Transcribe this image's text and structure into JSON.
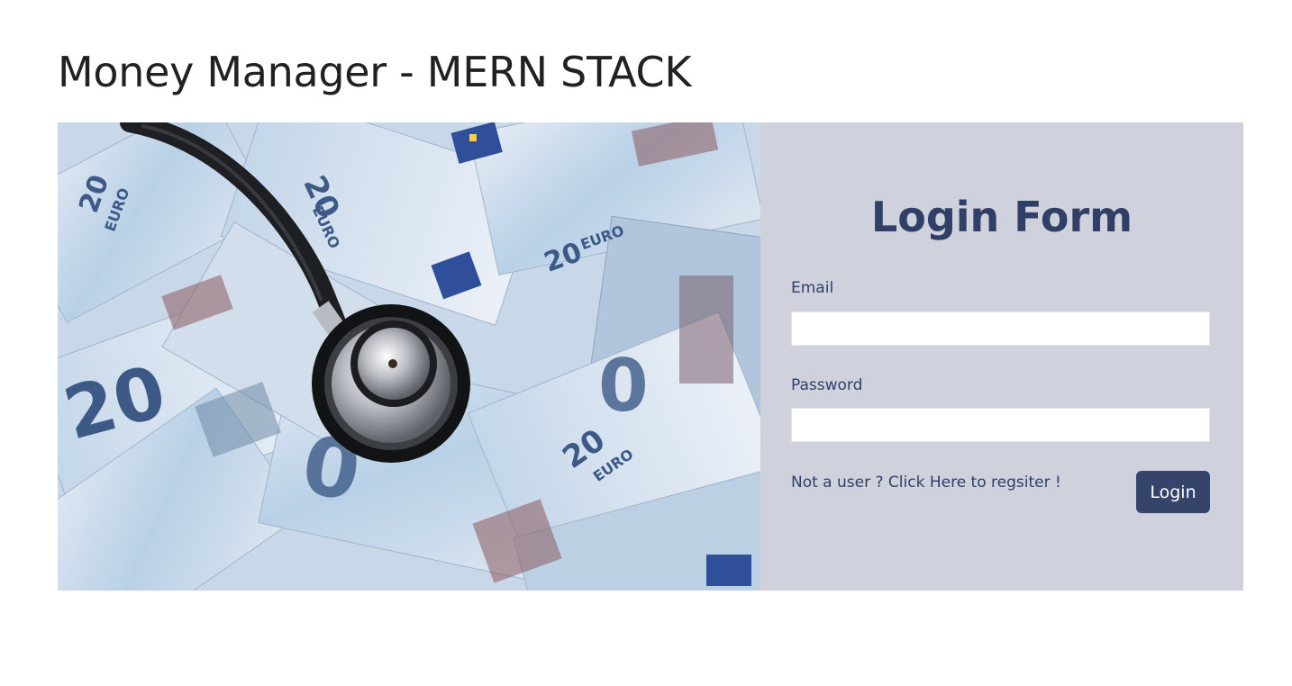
{
  "app": {
    "title": "Money Manager - MERN STACK"
  },
  "hero": {
    "image_subject": "euro-banknotes-with-stethoscope",
    "banknote_value": "20",
    "banknote_currency": "EURO"
  },
  "login": {
    "title": "Login Form",
    "email_label": "Email",
    "email_value": "",
    "password_label": "Password",
    "password_value": "",
    "register_text": "Not a user ? Click Here to regsiter !",
    "submit_label": "Login"
  },
  "colors": {
    "accent": "#34446a",
    "heading": "#2f3f66",
    "panel_bg": "#cfd1dd",
    "title_text": "#212121"
  }
}
